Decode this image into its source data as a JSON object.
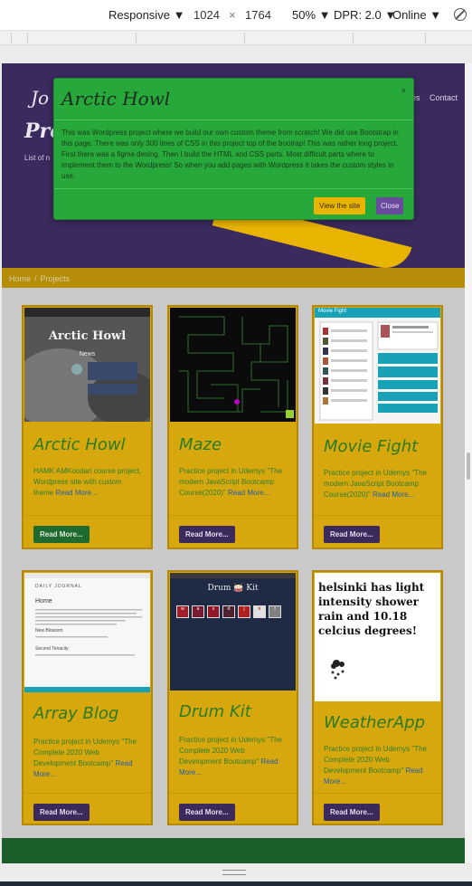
{
  "devtools": {
    "device": "Responsive",
    "width": "1024",
    "times": "×",
    "height": "1764",
    "zoom": "50%",
    "dpr": "DPR: 2.0",
    "network": "Online"
  },
  "hero": {
    "brand": "Jo",
    "title": "Pro",
    "subtitle": "List of n",
    "nav": [
      "es",
      "Contact"
    ]
  },
  "breadcrumb": {
    "home": "Home",
    "sep": "/",
    "current": "Projects"
  },
  "modal": {
    "title": "Arctic Howl",
    "close": "×",
    "body": "This was Wordpress project where we build our own custom theme from scratch! We did use Bootstrap in this page. There was only 300 lines of CSS in this project top of the bootrap! This was rather long project. First thera was a figma desing. Then I build the HTML and CSS parts. Most difficult parts where to implement them to the Wordpress! So when you add pages with Wordpress it takes the custom styles in use.",
    "view_label": "View the site",
    "close_label": "Close"
  },
  "cards": [
    {
      "title": "Arctic Howl",
      "desc": "HAMK AMKoodari course project, Wordpress site with custom theme",
      "more": "Read More...",
      "button": "Read More...",
      "thumb": {
        "heading": "Arctic Howl",
        "subheading": "News"
      }
    },
    {
      "title": "Maze",
      "desc": "Practice project in Udemys \"The modern JavaScript Bootcamp Course(2020)\"",
      "more": "Read More...",
      "button": "Read More..."
    },
    {
      "title": "Movie Fight",
      "desc": "Practice project in Udemys \"The modern JavaScript Bootcamp Course(2020)\"",
      "more": "Read More...",
      "button": "Read More...",
      "thumb": {
        "heading": "Movie Fight"
      }
    },
    {
      "title": "Array Blog",
      "desc": "Practice project in Udemys \"The Complete 2020 Web Development Bootcamp\"",
      "more": "Read More...",
      "button": "Read More...",
      "thumb": {
        "heading": "DAILY JOURNAL",
        "section": "Home",
        "post1": "New Blossom",
        "post2": "Second Tenacity"
      }
    },
    {
      "title": "Drum Kit",
      "desc": "Practice project in Udemys \"The Complete 2020 Web Development Bootcamp\"",
      "more": "Read More...",
      "button": "Read More...",
      "thumb": {
        "heading": "Drum 🥁 Kit",
        "keys": [
          "w",
          "a",
          "s",
          "d",
          "j",
          "k",
          "l"
        ]
      }
    },
    {
      "title": "WeatherApp",
      "desc": "Practice project in Udemys \"The Complete 2020 Web Development Bootcamp\"",
      "more": "Read More...",
      "button": "Read More...",
      "thumb": {
        "weather": "helsinki has light intensity shower rain and 10.18 celcius degrees!"
      }
    }
  ]
}
